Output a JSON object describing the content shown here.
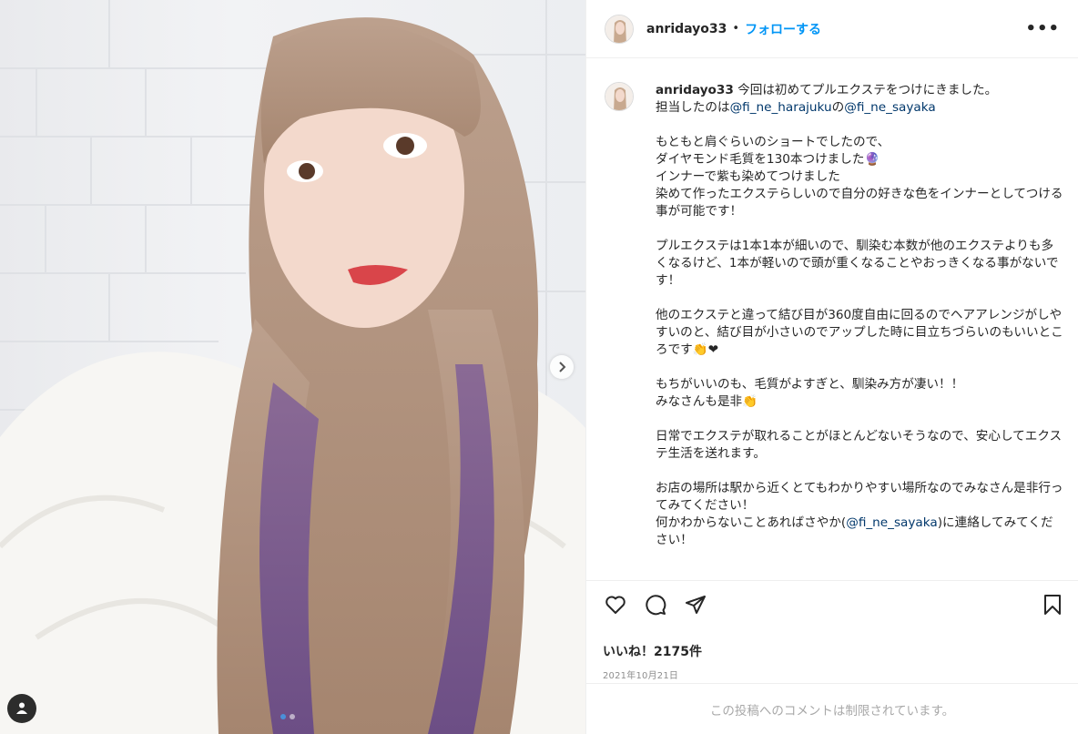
{
  "post": {
    "username": "anridayo33",
    "separator": "•",
    "follow_label": "フォローする",
    "more_label": "•••"
  },
  "caption": {
    "username": "anridayo33",
    "line1": " 今回は初めてプルエクステをつけにきました。\n担当したのは",
    "mention1": "@fi_ne_harajuku",
    "mid1": "の",
    "mention2": "@fi_ne_sayaka",
    "body": "\n\nもともと肩ぐらいのショートでしたので、\nダイヤモンド毛質を130本つけました🔮\nインナーで紫も染めてつけました\n染めて作ったエクステらしいので自分の好きな色をインナーとしてつける事が可能です！\n\nプルエクステは1本1本が細いので、馴染む本数が他のエクステよりも多くなるけど、1本が軽いので頭が重くなることやおっきくなる事がないです！\n\n他のエクステと違って結び目が360度自由に回るのでヘアアレンジがしやすいのと、結び目が小さいのでアップした時に目立ちづらいのもいいところです👏❤\n\nもちがいいのも、毛質がよすぎと、馴染み方が凄い！！\nみなさんも是非👏\n\n日常でエクステが取れることがほとんどないそうなので、安心してエクステ生活を送れます。\n\nお店の場所は駅から近くとてもわかりやすい場所なのでみなさん是非行ってみてください！\n何かわからないことあればさやか(",
    "mention3": "@fi_ne_sayaka",
    "tail": ")に連絡してみてください！"
  },
  "icons": {
    "like": "heart-icon",
    "comment": "comment-icon",
    "share": "paper-plane-icon",
    "save": "bookmark-icon",
    "next": "chevron-right-icon",
    "tags": "user-tag-icon"
  },
  "likes_text": "いいね！2175件",
  "date_text": "2021年10月21日",
  "comments_limited_text": "この投稿へのコメントは制限されています。",
  "carousel": {
    "total": 2,
    "current": 1
  },
  "colors": {
    "accent": "#0095f6",
    "mention": "#00376b",
    "text": "#262626",
    "muted": "#8e8e8e"
  }
}
